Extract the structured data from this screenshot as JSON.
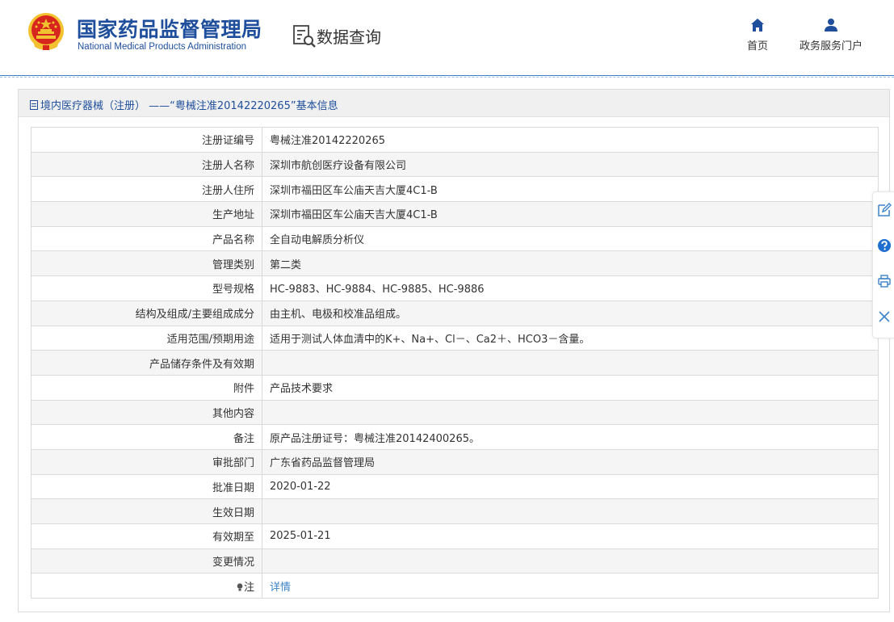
{
  "header": {
    "org_name_cn": "国家药品监督管理局",
    "org_name_en": "National Medical Products Administration",
    "query_title": "数据查询",
    "nav": {
      "home": "首页",
      "portal": "政务服务门户"
    }
  },
  "panel": {
    "title": "境内医疗器械（注册） ——“粤械注准20142220265”基本信息"
  },
  "rows": [
    {
      "label": "注册证编号",
      "value": "粤械注准20142220265"
    },
    {
      "label": "注册人名称",
      "value": "深圳市航创医疗设备有限公司"
    },
    {
      "label": "注册人住所",
      "value": "深圳市福田区车公庙天吉大厦4C1-B"
    },
    {
      "label": "生产地址",
      "value": "深圳市福田区车公庙天吉大厦4C1-B"
    },
    {
      "label": "产品名称",
      "value": "全自动电解质分析仪"
    },
    {
      "label": "管理类别",
      "value": "第二类"
    },
    {
      "label": "型号规格",
      "value": "HC-9883、HC-9884、HC-9885、HC-9886"
    },
    {
      "label": "结构及组成/主要组成成分",
      "value": "由主机、电极和校准品组成。"
    },
    {
      "label": "适用范围/预期用途",
      "value": "适用于测试人体血清中的K+、Na+、Cl－、Ca2＋、HCO3－含量。"
    },
    {
      "label": "产品储存条件及有效期",
      "value": ""
    },
    {
      "label": "附件",
      "value": "产品技术要求"
    },
    {
      "label": "其他内容",
      "value": ""
    },
    {
      "label": "备注",
      "value": "原产品注册证号：粤械注准20142400265。"
    },
    {
      "label": "审批部门",
      "value": "广东省药品监督管理局"
    },
    {
      "label": "批准日期",
      "value": "2020-01-22"
    },
    {
      "label": "生效日期",
      "value": ""
    },
    {
      "label": "有效期至",
      "value": "2025-01-21"
    },
    {
      "label": "变更情况",
      "value": ""
    },
    {
      "label": "注",
      "value": "详情"
    }
  ],
  "side_tools": [
    "edit-icon",
    "help-icon",
    "print-icon",
    "close-icon"
  ],
  "colors": {
    "brand_blue": "#1f4f9c",
    "link_blue": "#3d83c8",
    "emblem_red": "#d7261e",
    "emblem_gold": "#f2c230"
  }
}
